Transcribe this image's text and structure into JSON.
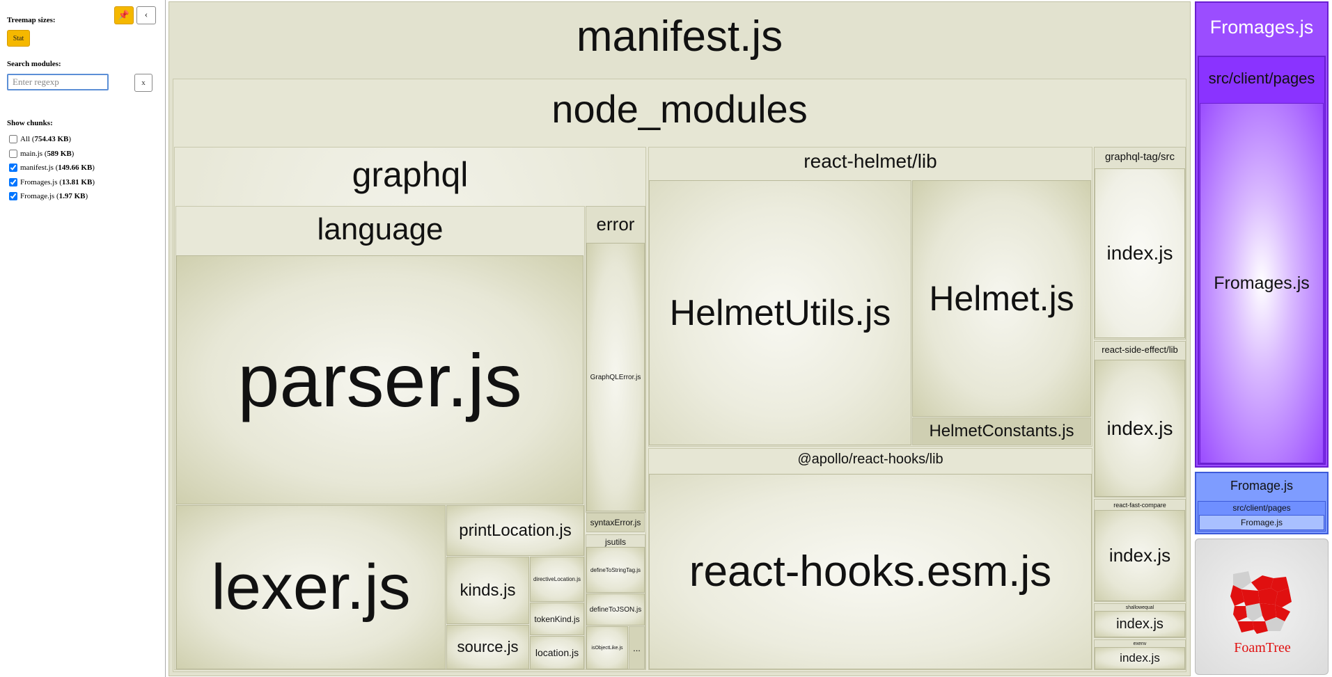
{
  "sidebar": {
    "treemap_sizes_label": "Treemap sizes:",
    "stat_button": "Stat",
    "search_label": "Search modules:",
    "search_placeholder": "Enter regexp",
    "search_clear": "x",
    "show_chunks_label": "Show chunks:",
    "chunks": [
      {
        "name": "All",
        "size": "754.43 KB",
        "checked": false
      },
      {
        "name": "main.js",
        "size": "589 KB",
        "checked": false
      },
      {
        "name": "manifest.js",
        "size": "149.66 KB",
        "checked": true
      },
      {
        "name": "Fromages.js",
        "size": "13.81 KB",
        "checked": true
      },
      {
        "name": "Fromage.js",
        "size": "1.97 KB",
        "checked": true
      }
    ]
  },
  "treemap": {
    "manifest": "manifest.js",
    "node_modules": "node_modules",
    "graphql": "graphql",
    "language": "language",
    "parser": "parser.js",
    "lexer": "lexer.js",
    "printLocation": "printLocation.js",
    "kinds": "kinds.js",
    "directiveLocation": "directiveLocation.js",
    "tokenKind": "tokenKind.js",
    "source": "source.js",
    "location": "location.js",
    "error": "error",
    "graphqlError": "GraphQLError.js",
    "syntaxError": "syntaxError.js",
    "jsutils": "jsutils",
    "defineToStringTag": "defineToStringTag.js",
    "defineToJSON": "defineToJSON.js",
    "isObjectLike": "isObjectLike.js",
    "more": "...",
    "reactHelmet": "react-helmet/lib",
    "helmetUtils": "HelmetUtils.js",
    "helmet": "Helmet.js",
    "helmetConstants": "HelmetConstants.js",
    "apolloHooks": "@apollo/react-hooks/lib",
    "reactHooksEsm": "react-hooks.esm.js",
    "graphqlTag": "graphql-tag/src",
    "graphqlTagIndex": "index.js",
    "reactSideEffect": "react-side-effect/lib",
    "reactSideEffectIndex": "index.js",
    "reactFastCompare": "react-fast-compare",
    "reactFastCompareIndex": "index.js",
    "shallowequal": "shallowequal",
    "shallowequalIndex": "index.js",
    "exenv": "exenv",
    "exenvIndex": "index.js",
    "fromagesChunk": "Fromages.js",
    "fromagesPages": "src/client/pages",
    "fromagesFile": "Fromages.js",
    "fromageChunk": "Fromage.js",
    "fromagePages": "src/client/pages",
    "fromageFile": "Fromage.js",
    "foamtree": "FoamTree"
  },
  "colors": {
    "accent": "#f5b800",
    "purple": "#9b4dff",
    "blue": "#7e9cff",
    "olive": "#e2e2cf"
  }
}
